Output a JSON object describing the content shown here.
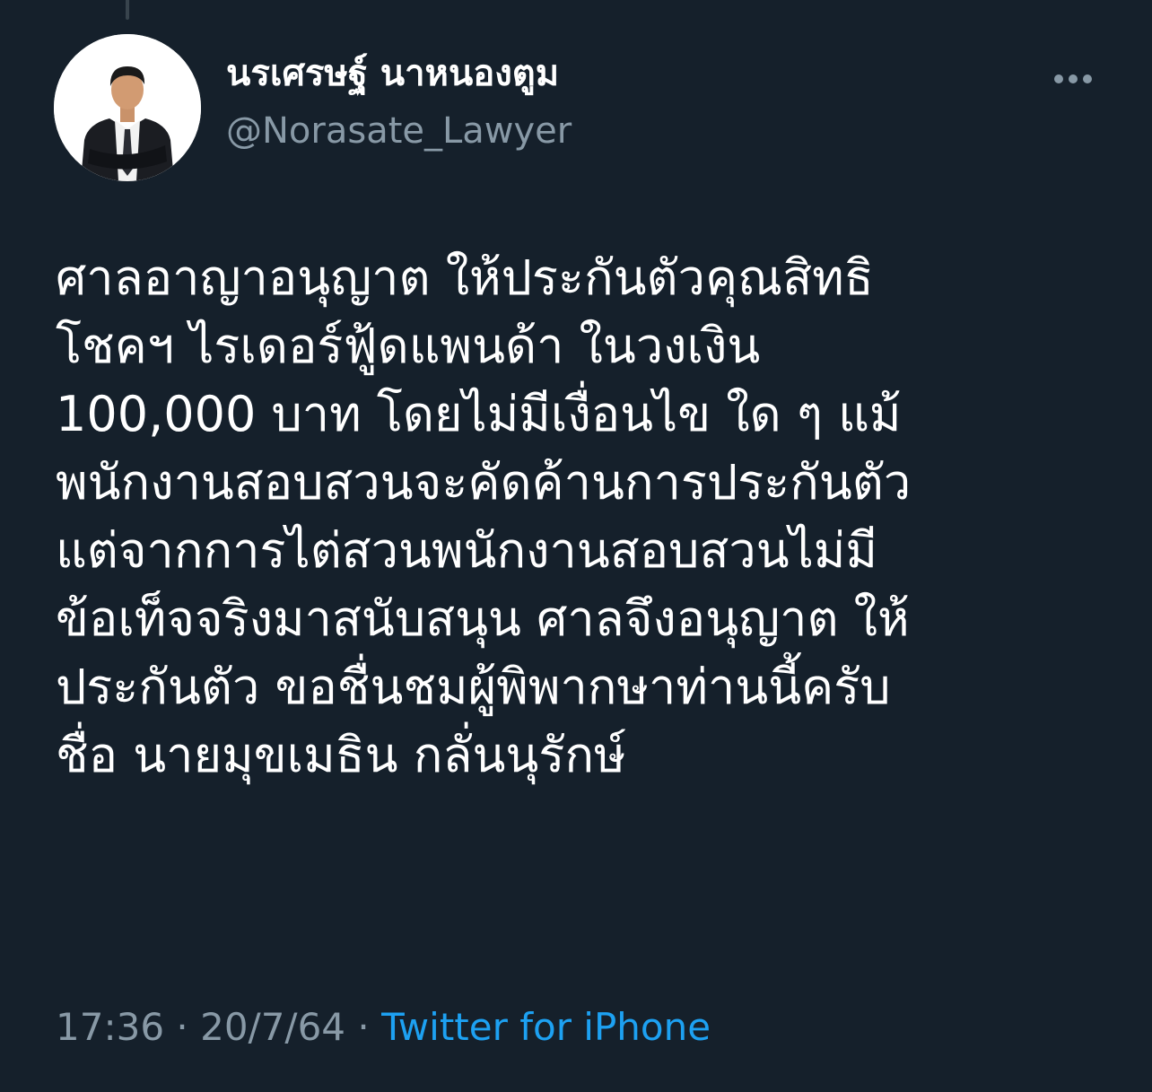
{
  "colors": {
    "background": "#15202b",
    "text_primary": "#ffffff",
    "text_secondary": "#8899a6",
    "link": "#1da1f2"
  },
  "author": {
    "display_name": "นรเศรษฐ์ นาหนองตูม",
    "handle": "@Norasate_Lawyer",
    "avatar_icon": "profile-photo"
  },
  "more_icon": "ellipsis-horizontal-icon",
  "tweet": {
    "lines": [
      "ศาลอาญาอนุญาต ให้ประกันตัวคุณสิทธิ",
      "โชคฯ ไรเดอร์ฟู้ดแพนด้า  ในวงเงิน",
      "100,000 บาท โดยไม่มีเงื่อนไข ใด ๆ แม้",
      "พนักงานสอบสวนจะคัดค้านการประกันตัว",
      "แต่จากการไต่สวนพนักงานสอบสวนไม่มี",
      "ข้อเท็จจริงมาสนับสนุน ศาลจึงอนุญาต ให้",
      "ประกันตัว ขอชื่นชมผู้พิพากษาท่านนี้ครับ",
      "ชื่อ นายมุขเมธิน กลั่นนุรักษ์"
    ]
  },
  "meta": {
    "time": "17:36",
    "date": "20/7/64",
    "separator": " · ",
    "source": "Twitter for iPhone"
  }
}
